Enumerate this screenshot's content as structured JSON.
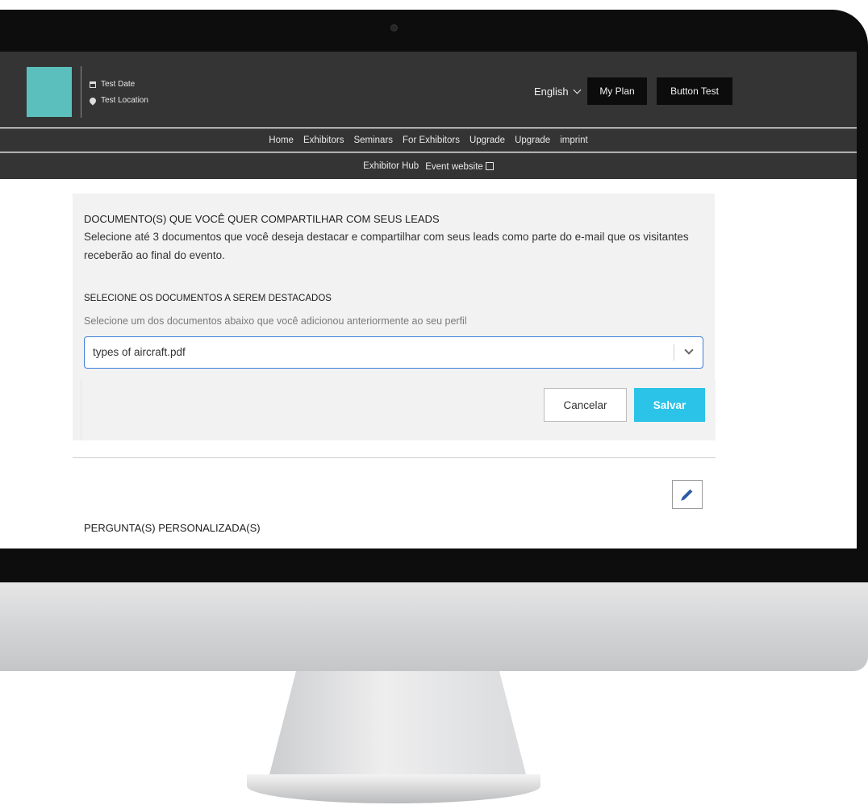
{
  "header": {
    "event_date": "Test Date",
    "event_location": "Test Location",
    "language": "English",
    "my_plan_label": "My Plan",
    "button_test_label": "Button Test",
    "logo_color": "#5bc0bd"
  },
  "nav": {
    "primary": [
      "Home",
      "Exhibitors",
      "Seminars",
      "For Exhibitors",
      "Upgrade",
      "Upgrade",
      "imprint"
    ],
    "secondary": [
      "Exhibitor Hub",
      "Event website"
    ]
  },
  "documents": {
    "title": "DOCUMENTO(S) QUE VOCÊ QUER COMPARTILHAR COM SEUS LEADS",
    "description": "Selecione até 3 documentos que você deseja destacar e compartilhar com seus leads como parte do e-mail que os visitantes receberão ao final do evento.",
    "select_heading": "SELECIONE OS DOCUMENTOS A SEREM DESTACADOS",
    "select_help": "Selecione um dos documentos abaixo que você adicionou anteriormente ao seu perfil",
    "selected_value": "types of aircraft.pdf",
    "cancel_label": "Cancelar",
    "save_label": "Salvar",
    "save_color": "#2bc3e8"
  },
  "questions": {
    "title": "PERGUNTA(S) PERSONALIZADA(S)"
  }
}
